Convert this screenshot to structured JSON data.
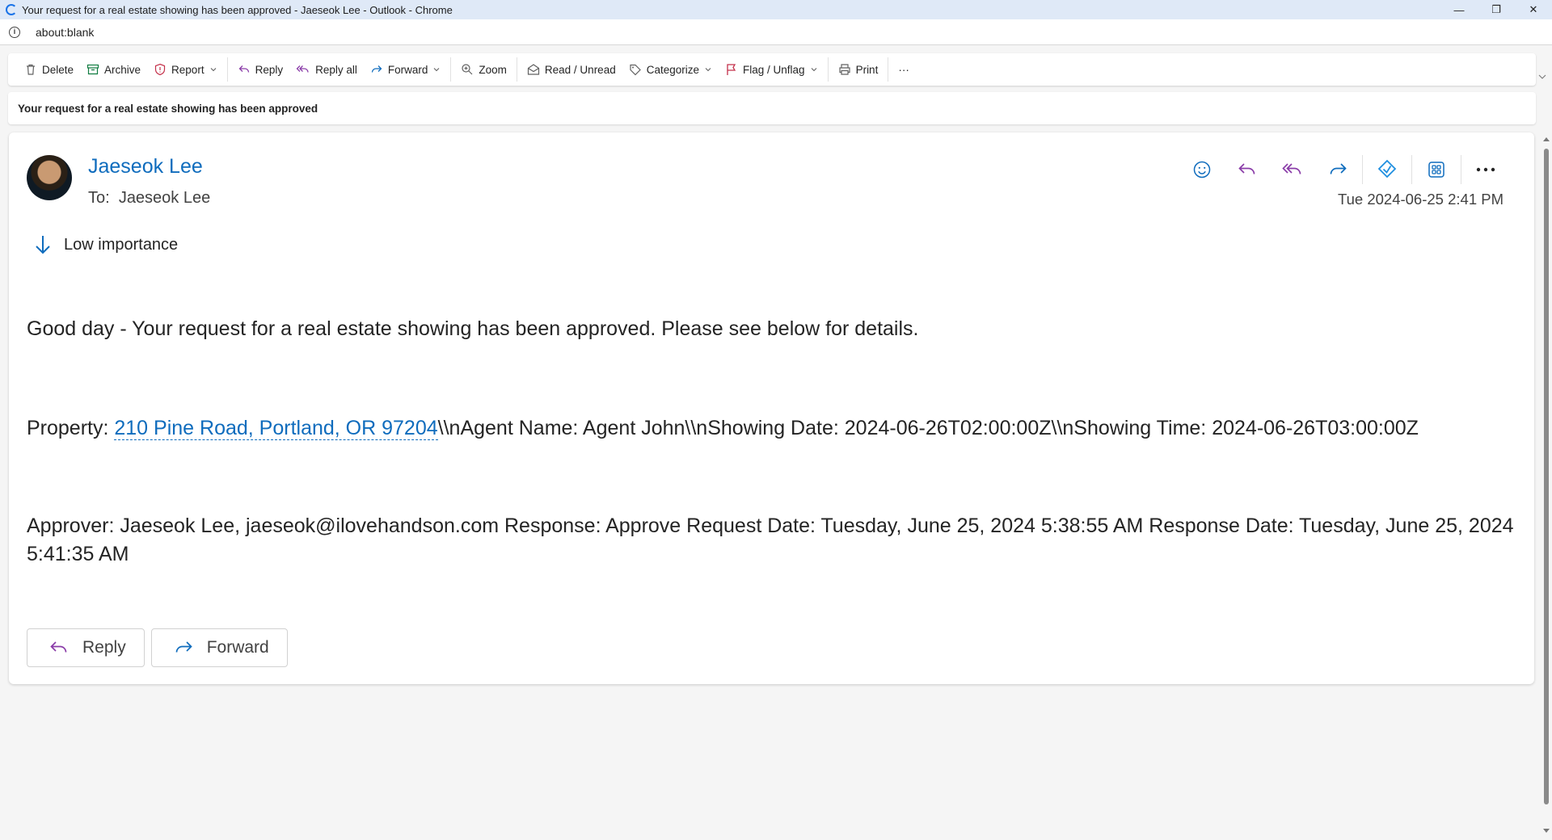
{
  "window": {
    "title": "Your request for a real estate showing has been approved - Jaeseok Lee - Outlook - Chrome",
    "minimize": "—",
    "restore": "❐",
    "close": "✕"
  },
  "address": {
    "url": "about:blank"
  },
  "toolbar": {
    "delete": "Delete",
    "archive": "Archive",
    "report": "Report",
    "reply": "Reply",
    "reply_all": "Reply all",
    "forward": "Forward",
    "zoom": "Zoom",
    "read_unread": "Read / Unread",
    "categorize": "Categorize",
    "flag_unflag": "Flag / Unflag",
    "print": "Print",
    "more": "···"
  },
  "subject": "Your request for a real estate showing has been approved",
  "message": {
    "sender": "Jaeseok Lee",
    "to_label": "To:",
    "to_name": "Jaeseok Lee",
    "timestamp": "Tue 2024-06-25 2:41 PM",
    "importance": "Low importance",
    "body": {
      "greeting": "Good day - Your request for a real estate showing has been approved. Please see below for details.",
      "property_label": "Property: ",
      "property_link": "210 Pine Road, Portland, OR 97204",
      "property_rest": "\\\\nAgent Name: Agent John\\\\nShowing Date: 2024-06-26T02:00:00Z\\\\nShowing Time: 2024-06-26T03:00:00Z",
      "approver": "Approver: Jaeseok Lee, jaeseok@ilovehandson.com Response: Approve Request Date: Tuesday, June 25, 2024 5:38:55 AM Response Date: Tuesday, June 25, 2024 5:41:35 AM"
    },
    "reply_button": "Reply",
    "forward_button": "Forward"
  },
  "colors": {
    "accent_blue": "#0f6cbd",
    "reply_purple": "#8a3ca8",
    "flag_red": "#c4314b",
    "archive_green": "#107c41"
  }
}
